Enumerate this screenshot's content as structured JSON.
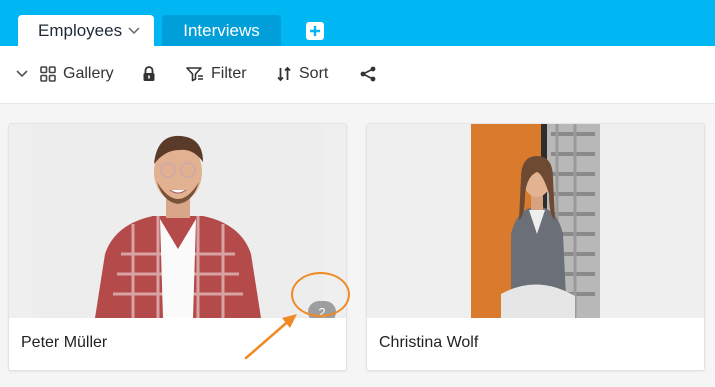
{
  "tabs": {
    "active_label": "Employees",
    "inactive_label": "Interviews"
  },
  "toolbar": {
    "view_label": "Gallery",
    "filter_label": "Filter",
    "sort_label": "Sort"
  },
  "cards": [
    {
      "name": "Peter Müller",
      "attachment_count": "2"
    },
    {
      "name": "Christina Wolf"
    }
  ],
  "colors": {
    "tabbar": "#00b7f3",
    "inactive_tab": "#009fd9",
    "highlight": "#f08a24"
  }
}
